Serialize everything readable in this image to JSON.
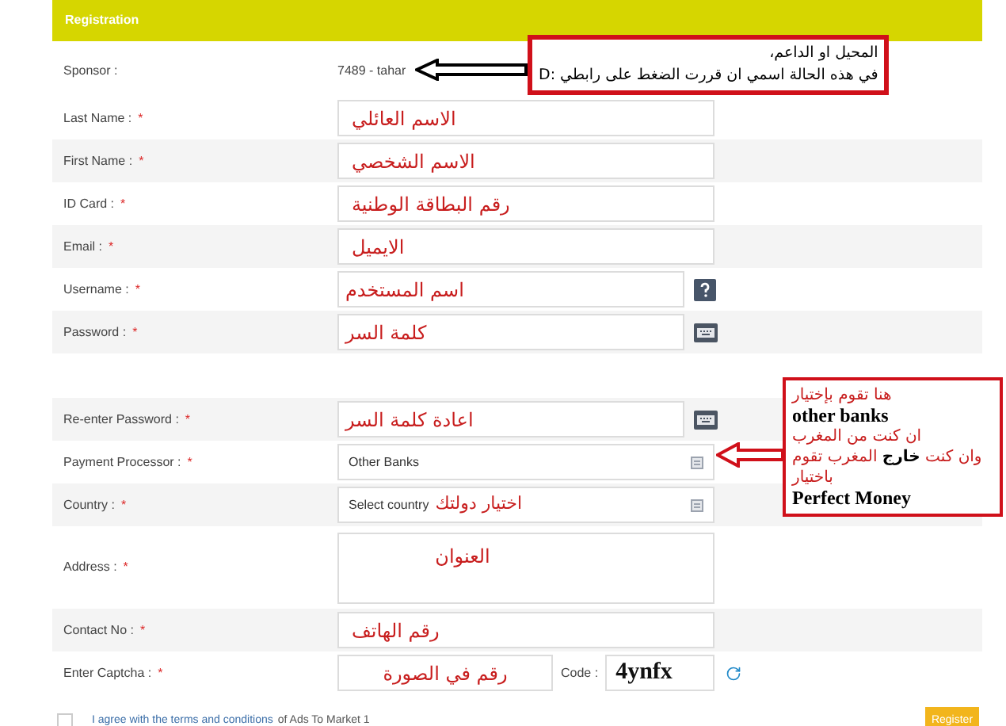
{
  "header": {
    "title": "Registration"
  },
  "sponsor": {
    "label": "Sponsor :",
    "value": "7489 - tahar"
  },
  "account_fields": [
    {
      "label": "Last Name :",
      "mark": "*",
      "kind": "text",
      "value": "الاسم العائلي"
    },
    {
      "label": "First Name :",
      "mark": "*",
      "kind": "text",
      "value": "الاسم الشخصي"
    },
    {
      "label": "ID Card :",
      "mark": "*",
      "kind": "text",
      "value": "رقم البطاقة الوطنية"
    },
    {
      "label": "Email :",
      "mark": "*",
      "kind": "text",
      "value": "الايميل"
    },
    {
      "label": "Username :",
      "mark": "*",
      "kind": "help",
      "value": "اسم المستخدم"
    },
    {
      "label": "Password :",
      "mark": "*",
      "kind": "keyboard",
      "value": "كلمة السر"
    }
  ],
  "profile_fields": [
    {
      "label": "Re-enter Password :",
      "mark": "*",
      "kind": "keyboard",
      "value": "اعادة كلمة السر"
    },
    {
      "label": "Payment Processor :",
      "mark": "*",
      "kind": "select",
      "value": "Other Banks"
    },
    {
      "label": "Country :",
      "mark": "*",
      "kind": "select",
      "value": "Select country",
      "note": "اختيار دولتك"
    },
    {
      "label": "Address :",
      "mark": "*",
      "kind": "textarea",
      "value": "العنوان"
    },
    {
      "label": "Contact No :",
      "mark": "*",
      "kind": "text",
      "value": "رقم الهاتف"
    },
    {
      "label": "Enter Captcha :",
      "mark": "*",
      "kind": "captcha",
      "value": "رقم في الصورة",
      "code_label": "Code :",
      "code": "4ynfx"
    }
  ],
  "agreement": {
    "checked": false,
    "link": "I agree with the terms and conditions",
    "text": "of Ads To Market 1"
  },
  "register_button": "Register",
  "annotations": [
    {
      "lines": [
        {
          "kind": "note",
          "text": "المحيل او الداعم،"
        },
        {
          "kind": "note",
          "text": "في هذه الحالة اسمي ان قررت الضغط على رابطي :D"
        }
      ]
    },
    {
      "lines": [
        {
          "kind": "red",
          "text": "هنا تقوم بإختيار"
        },
        {
          "kind": "emphasis",
          "text": "other banks"
        },
        {
          "kind": "red",
          "text": "ان كنت من المغرب"
        },
        {
          "kind": "red",
          "text": "وان كنت **خارج** المغرب تقوم"
        },
        {
          "kind": "red",
          "text": "باختيار"
        },
        {
          "kind": "emphasis",
          "text": "Perfect Money"
        }
      ]
    }
  ]
}
